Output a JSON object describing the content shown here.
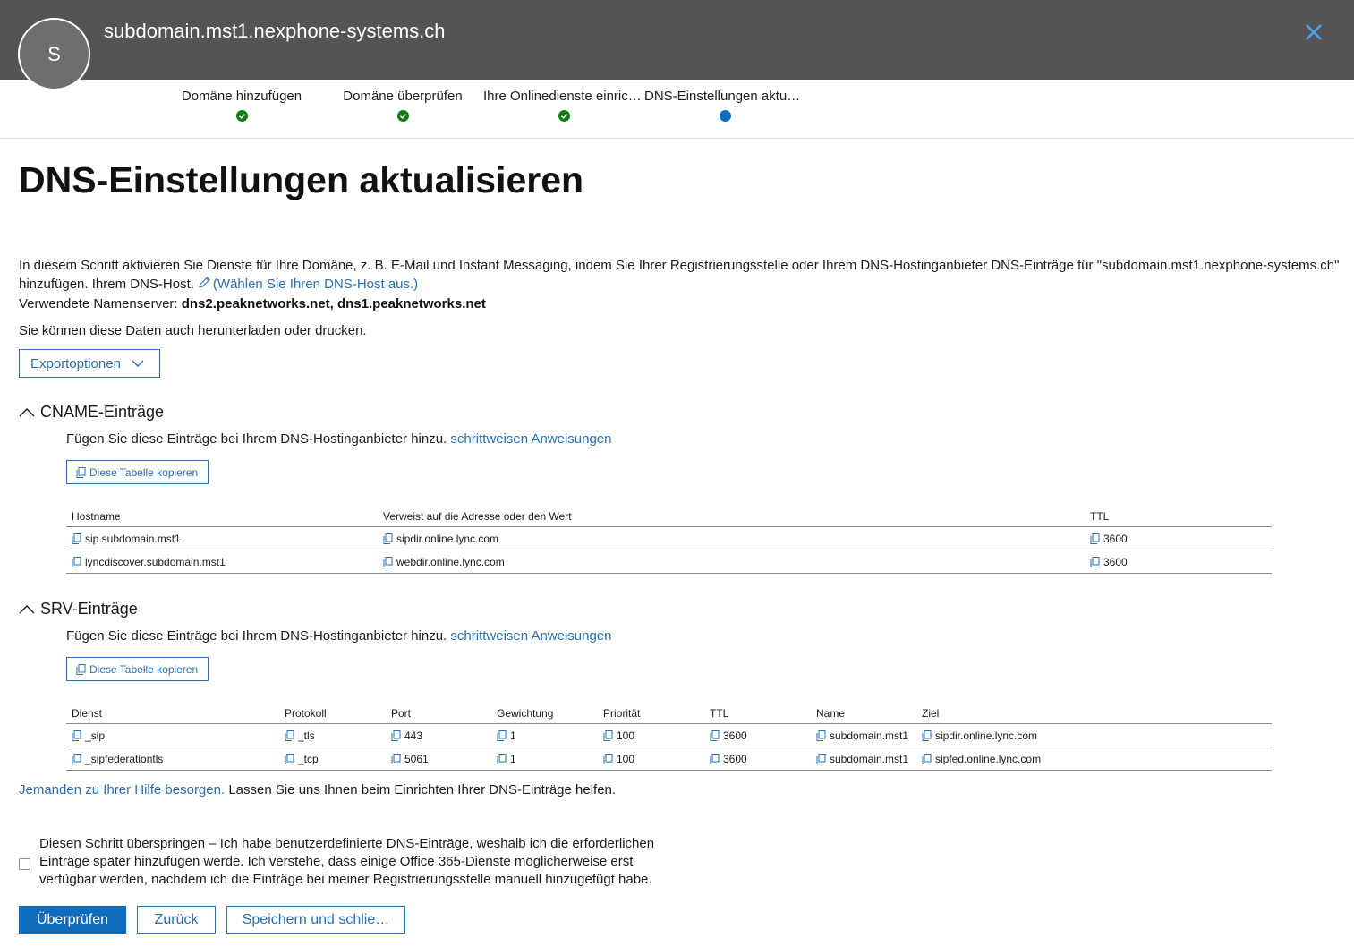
{
  "header": {
    "avatar_initial": "S",
    "title": "subdomain.mst1.nexphone-systems.ch"
  },
  "steps": [
    {
      "label": "Domäne hinzufügen",
      "status": "complete"
    },
    {
      "label": "Domäne überprüfen",
      "status": "complete"
    },
    {
      "label": "Ihre Onlinedienste einrichten",
      "status": "complete"
    },
    {
      "label": "DNS-Einstellungen aktualisieren",
      "status": "current"
    }
  ],
  "page": {
    "title": "DNS-Einstellungen aktualisieren",
    "intro_text": "In diesem Schritt aktivieren Sie Dienste für Ihre Domäne, z. B. E-Mail und Instant Messaging, indem Sie Ihrer Registrierungsstelle oder Ihrem DNS-Hostinganbieter DNS-Einträge für \"subdomain.mst1.nexphone-systems.ch\"",
    "intro_text_2": "hinzufügen. Ihrem DNS-Host.",
    "choose_host_link": "(Wählen Sie Ihren DNS-Host aus.)",
    "nameserver_label": "Verwendete Namenserver:",
    "nameserver_value": "dns2.peaknetworks.net, dns1.peaknetworks.net",
    "download_text": "Sie können diese Daten auch herunterladen oder drucken.",
    "export_label": "Exportoptionen"
  },
  "cname": {
    "title": "CNAME-Einträge",
    "instruction": "Fügen Sie diese Einträge bei Ihrem DNS-Hostinganbieter hinzu.",
    "instruction_link": "schrittweisen Anweisungen",
    "copy_table_label": "Diese Tabelle kopieren",
    "columns": [
      "Hostname",
      "Verweist auf die Adresse oder den Wert",
      "TTL"
    ],
    "rows": [
      [
        "sip.subdomain.mst1",
        "sipdir.online.lync.com",
        "3600"
      ],
      [
        "lyncdiscover.subdomain.mst1",
        "webdir.online.lync.com",
        "3600"
      ]
    ]
  },
  "srv": {
    "title": "SRV-Einträge",
    "instruction": "Fügen Sie diese Einträge bei Ihrem DNS-Hostinganbieter hinzu.",
    "instruction_link": "schrittweisen Anweisungen",
    "copy_table_label": "Diese Tabelle kopieren",
    "columns": [
      "Dienst",
      "Protokoll",
      "Port",
      "Gewichtung",
      "Priorität",
      "TTL",
      "Name",
      "Ziel"
    ],
    "rows": [
      [
        "_sip",
        "_tls",
        "443",
        "1",
        "100",
        "3600",
        "subdomain.mst1",
        "sipdir.online.lync.com"
      ],
      [
        "_sipfederationtls",
        "_tcp",
        "5061",
        "1",
        "100",
        "3600",
        "subdomain.mst1",
        "sipfed.online.lync.com"
      ]
    ]
  },
  "help": {
    "link": "Jemanden zu Ihrer Hilfe besorgen.",
    "text": "Lassen Sie uns Ihnen beim Einrichten Ihrer DNS-Einträge helfen."
  },
  "skip": {
    "checked": false,
    "text": "Diesen Schritt überspringen – Ich habe benutzerdefinierte DNS-Einträge, weshalb ich die erforderlichen Einträge später hinzufügen werde. Ich verstehe, dass einige Office 365-Dienste möglicherweise erst verfügbar werden, nachdem ich die Einträge bei meiner Registrierungsstelle manuell hinzugefügt habe."
  },
  "buttons": {
    "verify": "Überprüfen",
    "back": "Zurück",
    "save_close": "Speichern und schlie…"
  },
  "colors": {
    "header_bg": "#545454",
    "accent": "#0f6cbd",
    "link": "#2a6fb0",
    "success": "#107c10"
  }
}
